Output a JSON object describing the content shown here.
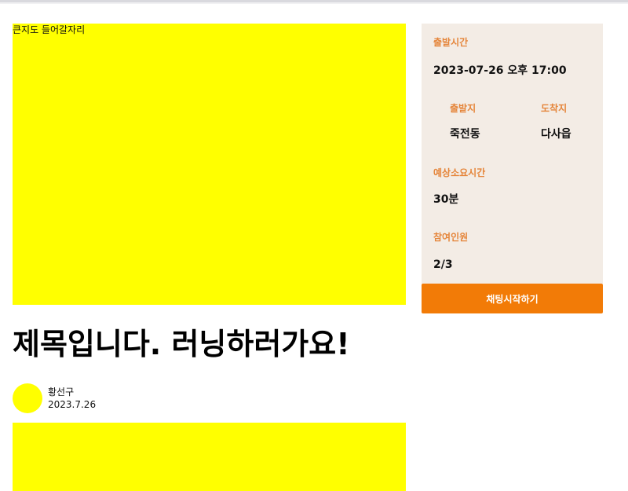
{
  "map": {
    "placeholder": "큰지도 들어갈자리"
  },
  "post": {
    "title": "제목입니다. 러닝하러가요!",
    "author_name": "황선구",
    "date": "2023.7.26"
  },
  "details": {
    "departure_time_label": "출발시간",
    "departure_time_value": "2023-07-26 오후 17:00",
    "origin_label": "출발지",
    "origin_value": "죽전동",
    "destination_label": "도착지",
    "destination_value": "다사읍",
    "duration_label": "예상소요시간",
    "duration_value": "30분",
    "participants_label": "참여인원",
    "participants_value": "2/3"
  },
  "actions": {
    "start_chat_label": "채팅시작하기"
  },
  "colors": {
    "placeholder_yellow": "#ffff00",
    "panel_background": "#f3ece5",
    "label_orange": "#e5853a",
    "button_orange": "#f27b07"
  }
}
